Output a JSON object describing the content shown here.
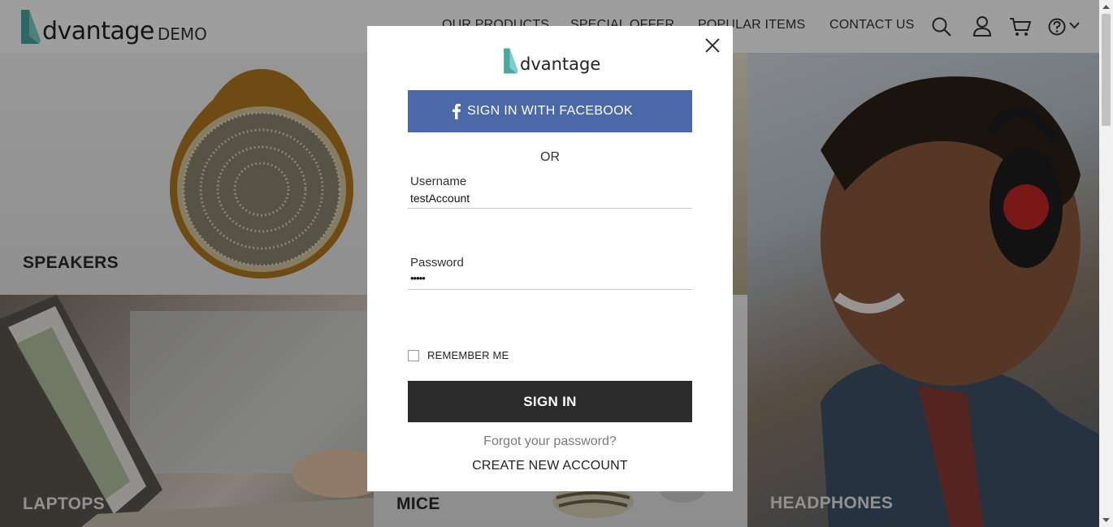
{
  "header": {
    "logo_word": "dvantage",
    "logo_suffix": "DEMO",
    "nav": {
      "our_products": "OUR PRODUCTS",
      "special_offer": "SPECIAL OFFER",
      "popular_items": "POPULAR ITEMS",
      "contact_us": "CONTACT US"
    },
    "icons": [
      "search-icon",
      "user-icon",
      "cart-icon",
      "help-icon",
      "chevron-down-icon"
    ]
  },
  "categories": {
    "speakers": "SPEAKERS",
    "laptops": "LAPTOPS",
    "mice": "MICE",
    "headphones": "HEADPHONES"
  },
  "modal": {
    "logo_word": "dvantage",
    "facebook_label": "SIGN IN WITH FACEBOOK",
    "or_label": "OR",
    "username_label": "Username",
    "username_value": "testAccount",
    "password_label": "Password",
    "password_value": "•••••",
    "remember_label": "REMEMBER ME",
    "remember_checked": false,
    "signin_label": "SIGN IN",
    "forgot_label": "Forgot your password?",
    "create_label": "CREATE NEW ACCOUNT"
  },
  "colors": {
    "brand_teal": "#5cb8b2",
    "facebook_blue": "#4b68a8",
    "signin_dark": "#2b2b2b"
  }
}
